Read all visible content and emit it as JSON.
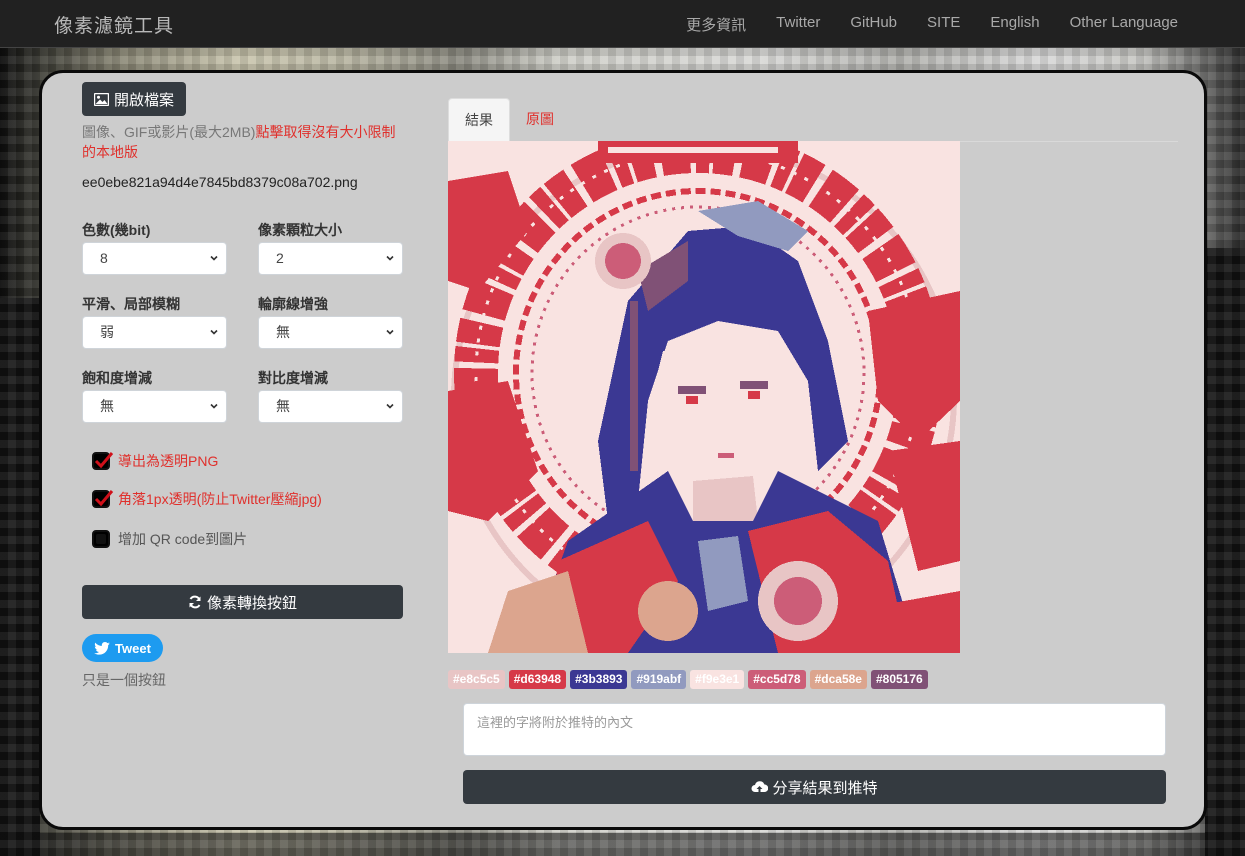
{
  "navbar": {
    "brand": "像素濾鏡工具",
    "links": [
      "更多資訊",
      "Twitter",
      "GitHub",
      "SITE",
      "English",
      "Other Language"
    ]
  },
  "left": {
    "open_button": "開啟檔案",
    "hint_prefix": "圖像、GIF或影片(最大2MB)",
    "hint_link": "點擊取得沒有大小限制的本地版",
    "filename": "ee0ebe821a94d4e7845bd8379c08a702.png",
    "fields": [
      {
        "label": "色數(幾bit)",
        "value": "8"
      },
      {
        "label": "像素顆粒大小",
        "value": "2"
      },
      {
        "label": "平滑、局部模糊",
        "value": "弱"
      },
      {
        "label": "輪廓線增強",
        "value": "無"
      },
      {
        "label": "飽和度增減",
        "value": "無"
      },
      {
        "label": "對比度增減",
        "value": "無"
      }
    ],
    "checks": [
      {
        "label": "導出為透明PNG",
        "checked": true,
        "color": "#e0302c"
      },
      {
        "label": "角落1px透明(防止Twitter壓縮jpg)",
        "checked": true,
        "color": "#e0302c"
      },
      {
        "label": "增加 QR code到圖片",
        "checked": false,
        "color": "#555555"
      }
    ],
    "convert_button": "像素轉換按鈕",
    "tweet_button": "Tweet",
    "only_button_text": "只是一個按鈕"
  },
  "right": {
    "tabs": [
      "結果",
      "原圖"
    ],
    "palette": [
      {
        "hex": "#e8c5c5",
        "label": "#e8c5c5"
      },
      {
        "hex": "#d63948",
        "label": "#d63948"
      },
      {
        "hex": "#3b3893",
        "label": "#3b3893"
      },
      {
        "hex": "#919abf",
        "label": "#919abf"
      },
      {
        "hex": "#f9e3e1",
        "label": "#f9e3e1"
      },
      {
        "hex": "#cc5d78",
        "label": "#cc5d78"
      },
      {
        "hex": "#dca58e",
        "label": "#dca58e"
      },
      {
        "hex": "#805176",
        "label": "#805176"
      }
    ],
    "tweet_placeholder": "這裡的字將附於推特的內文",
    "share_button": "分享結果到推特"
  }
}
